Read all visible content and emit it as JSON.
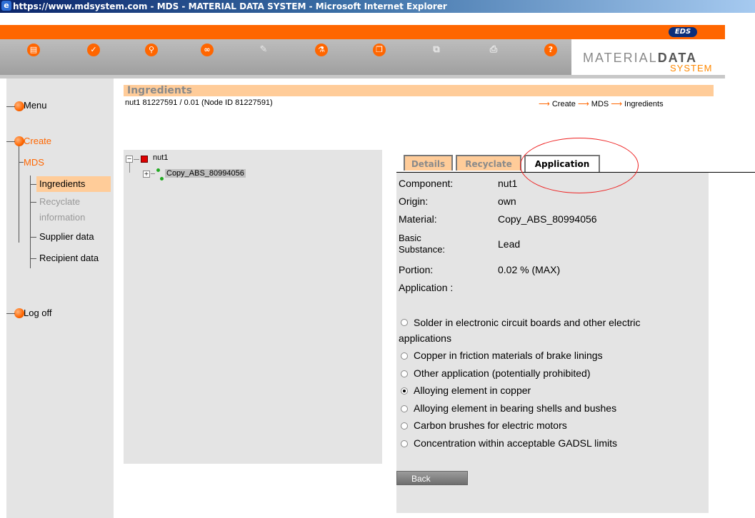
{
  "window": {
    "title": "https://www.mdsystem.com - MDS - MATERIAL DATA SYSTEM - Microsoft Internet Explorer"
  },
  "brand": {
    "logo_text": "EDS",
    "name_light": "MATERIAL",
    "name_bold": "DATA",
    "name_sub": "SYSTEM",
    "accent": "#ff6600",
    "highlight": "#ffcc99",
    "panel": "#e4e4e4"
  },
  "toolbar": {
    "icons": [
      "save-icon",
      "check-icon",
      "search-icon",
      "link-icon",
      "edit-icon",
      "flask-icon",
      "copy-icon",
      "compare-icon",
      "print-icon",
      "help-icon"
    ]
  },
  "nav": {
    "menu": "Menu",
    "create": "Create",
    "mds": "MDS",
    "ingredients": "Ingredients",
    "recycle_line1": "Recyclate",
    "recycle_line2": "information",
    "supplier": "Supplier data",
    "recipient": "Recipient data",
    "logoff": "Log off"
  },
  "page": {
    "heading": "Ingredients",
    "subtitle": "nut1 81227591 / 0.01 (Node ID 81227591)",
    "breadcrumb": [
      "Create",
      "MDS",
      "Ingredients"
    ]
  },
  "tree": {
    "root": "nut1",
    "child": "Copy_ABS_80994056"
  },
  "tabs": {
    "details": "Details",
    "recyclate": "Recyclate",
    "application": "Application"
  },
  "detail": {
    "component_label": "Component:",
    "component_value": "nut1",
    "origin_label": "Origin:",
    "origin_value": "own",
    "material_label": "Material:",
    "material_value": "Copy_ABS_80994056",
    "basic_label_1": "Basic",
    "basic_label_2": "Substance:",
    "basic_value": "Lead",
    "portion_label": "Portion:",
    "portion_value": "0.02 % (MAX)",
    "application_label": "Application :"
  },
  "options": {
    "opt1_line1": "Solder in electronic circuit boards and other electric",
    "opt1_line2": "applications",
    "opt2": "Copper in friction materials of brake linings",
    "opt3": "Other application (potentially prohibited)",
    "opt4": "Alloying element in copper",
    "opt5": "Alloying element in bearing shells and bushes",
    "opt6": "Carbon brushes for electric motors",
    "opt7": "Concentration within acceptable GADSL limits",
    "selected": "Alloying element in copper"
  },
  "buttons": {
    "back": "Back"
  }
}
